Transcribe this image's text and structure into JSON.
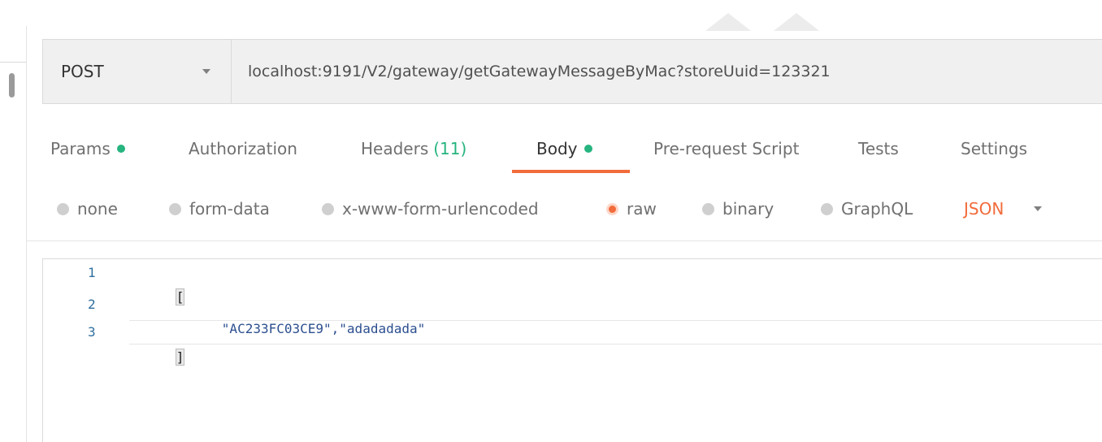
{
  "request": {
    "method": "POST",
    "url": "localhost:9191/V2/gateway/getGatewayMessageByMac?storeUuid=123321"
  },
  "tabs": [
    {
      "label": "Params",
      "indicator": "dot"
    },
    {
      "label": "Authorization"
    },
    {
      "label": "Headers",
      "count": "(11)"
    },
    {
      "label": "Body",
      "indicator": "dot",
      "active": true
    },
    {
      "label": "Pre-request Script"
    },
    {
      "label": "Tests"
    },
    {
      "label": "Settings"
    }
  ],
  "body_types": {
    "options": [
      "none",
      "form-data",
      "x-www-form-urlencoded",
      "raw",
      "binary",
      "GraphQL"
    ],
    "selected": "raw",
    "format": "JSON"
  },
  "editor": {
    "lines": [
      {
        "number": "1",
        "text": "["
      },
      {
        "number": "2",
        "text": "\"AC233FC03CE9\",\"adadadada\""
      },
      {
        "number": "3",
        "text": "]"
      }
    ]
  },
  "colors": {
    "accent": "#f26b3a",
    "indicator_green": "#26b47f",
    "string_blue": "#2c4f8f",
    "line_number_blue": "#2f6f9f"
  },
  "icons": {
    "method_dropdown": "chevron-down-icon",
    "format_dropdown": "chevron-down-icon"
  }
}
